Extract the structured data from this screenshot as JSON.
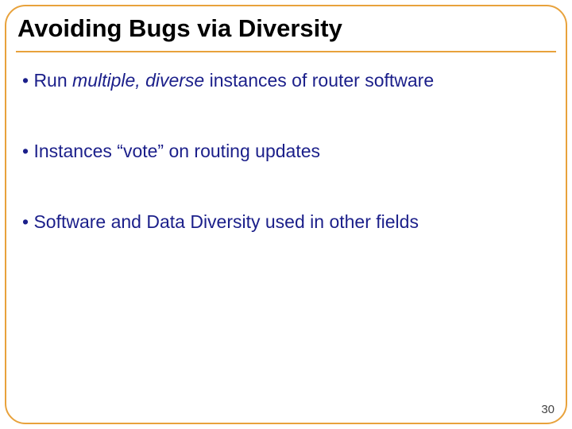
{
  "title": "Avoiding Bugs via Diversity",
  "bullets": {
    "b1_prefix": "• Run ",
    "b1_em": "multiple, diverse",
    "b1_suffix": " instances of router software",
    "b2": "• Instances “vote” on routing updates",
    "b3": "• Software and Data Diversity used in other fields"
  },
  "page_number": "30"
}
